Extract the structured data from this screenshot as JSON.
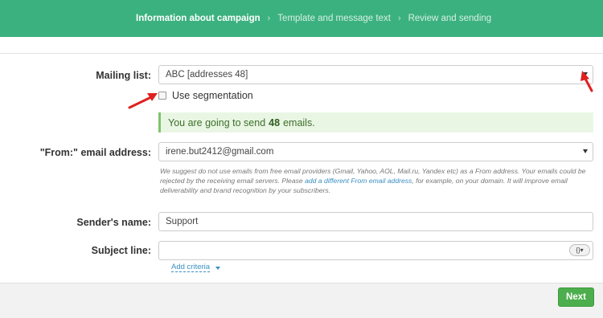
{
  "steps": [
    {
      "label": "Information about campaign",
      "active": true
    },
    {
      "label": "Template and message text",
      "active": false
    },
    {
      "label": "Review and sending",
      "active": false
    }
  ],
  "step_separator": "›",
  "form": {
    "mailing_list_label": "Mailing list:",
    "mailing_list_value": "ABC [addresses 48]",
    "segmentation_label": "Use segmentation",
    "segmentation_checked": false,
    "send_notice_prefix": "You are going to send",
    "send_notice_count": "48",
    "send_notice_suffix": "emails.",
    "from_label": "\"From:\" email address:",
    "from_value": "irene.but2412@gmail.com",
    "hint_part1": "We suggest do not use emails from free email providers (Gmail, Yahoo, AOL, Mail.ru, Yandex etc) as a From address. Your emails could be rejected by the receiving email servers. Please ",
    "hint_link": "add a different From email address",
    "hint_part2": ", for example, on your domain. It will improve email deliverability and brand recognition by your subscribers.",
    "sender_label": "Sender's name:",
    "sender_value": "Support",
    "subject_label": "Subject line:",
    "subject_value": "",
    "subject_icon_text": "{}▾",
    "add_criteria_label": "Add criteria"
  },
  "footer": {
    "next_label": "Next"
  },
  "colors": {
    "banner": "#3bb17f",
    "next_button": "#4cae4c",
    "success_bg": "#eaf6e4",
    "annotation_arrow": "#e02020"
  },
  "icons": {
    "dropdown": "chevron-down-icon",
    "step_separator": "chevron-right-icon",
    "subject_variables": "variables-icon",
    "annotation": "red-arrow-icon"
  }
}
